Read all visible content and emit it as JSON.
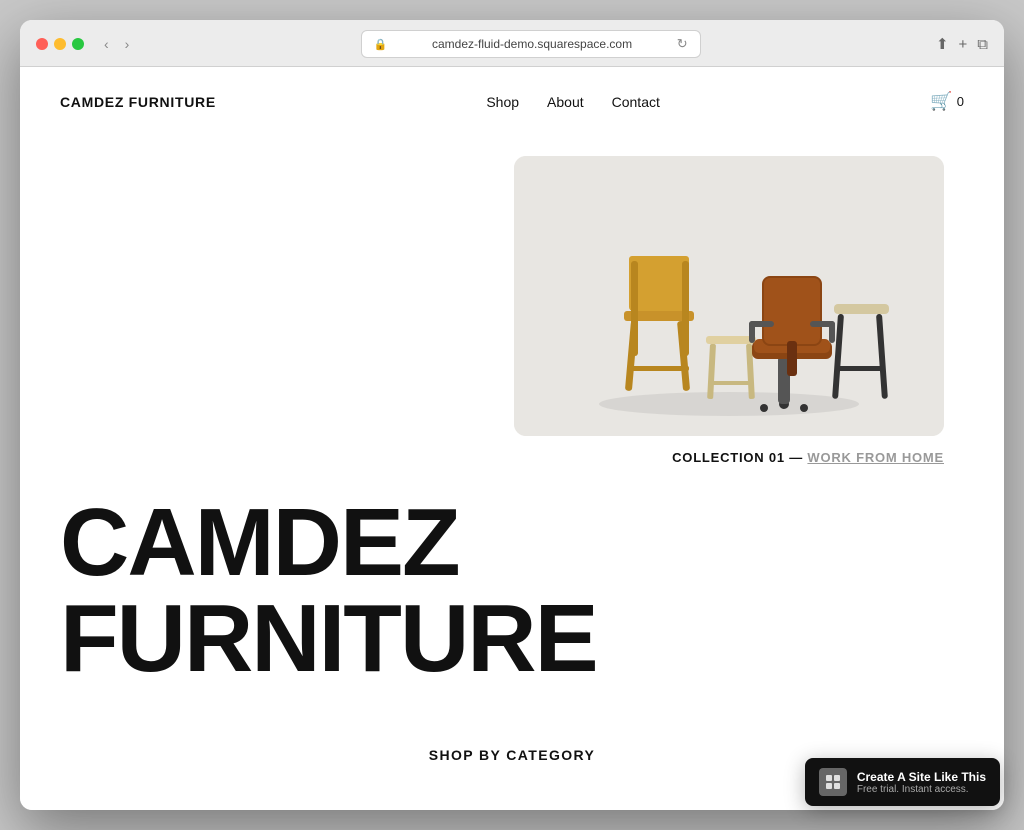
{
  "browser": {
    "url": "camdez-fluid-demo.squarespace.com",
    "back_btn": "‹",
    "forward_btn": "›"
  },
  "header": {
    "logo": "CAMDEZ FURNITURE",
    "nav": {
      "shop": "Shop",
      "about": "About",
      "contact": "Contact"
    },
    "cart_count": "0"
  },
  "collection": {
    "label_prefix": "COLLECTION 01 — ",
    "label_link": "WORK FROM HOME"
  },
  "headline": "CAMDEZ FURNITURE",
  "shop_by_category": {
    "title": "SHOP BY CATEGORY"
  },
  "squarespace_banner": {
    "logo_char": "◻",
    "main_text": "Create A Site Like This",
    "sub_text": "Free trial. Instant access."
  }
}
